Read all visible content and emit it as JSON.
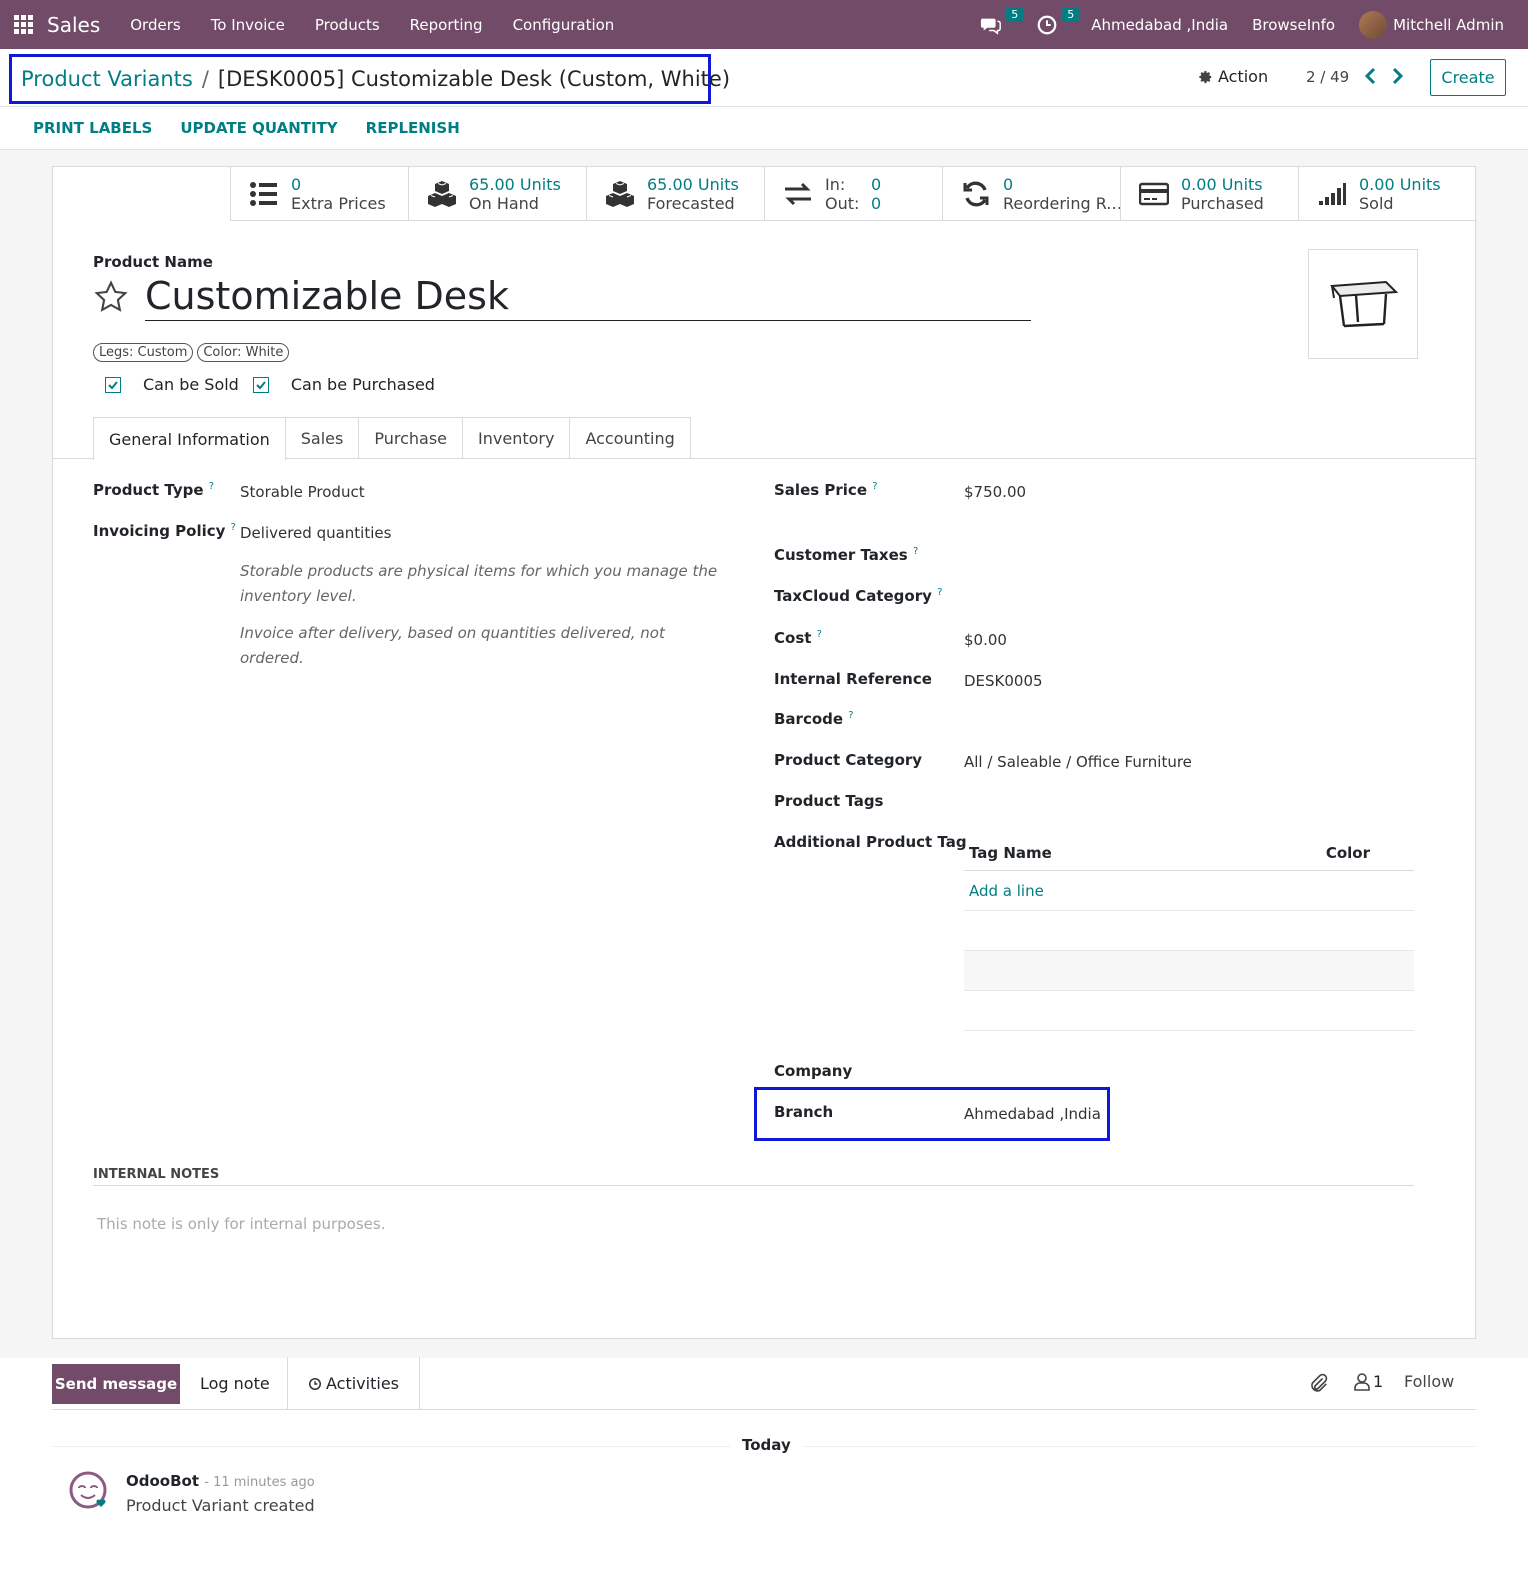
{
  "topnav": {
    "brand": "Sales",
    "menu": [
      "Orders",
      "To Invoice",
      "Products",
      "Reporting",
      "Configuration"
    ],
    "messages_count": "5",
    "activities_count": "5",
    "branch": "Ahmedabad ,India",
    "company": "BrowseInfo",
    "user": "Mitchell Admin",
    "accent": "#714b67"
  },
  "control": {
    "breadcrumb_parent": "Product Variants",
    "breadcrumb_sep": "/",
    "breadcrumb_current": "[DESK0005] Customizable Desk (Custom, White)",
    "action_label": "Action",
    "pager": "2 / 49",
    "create_label": "Create"
  },
  "header_buttons": [
    "PRINT LABELS",
    "UPDATE QUANTITY",
    "REPLENISH"
  ],
  "smart_buttons": {
    "extra_prices": {
      "value": "0",
      "label": "Extra Prices",
      "icon": "list-icon"
    },
    "on_hand": {
      "value": "65.00 Units",
      "label": "On Hand",
      "icon": "cubes-icon"
    },
    "forecasted": {
      "value": "65.00 Units",
      "label": "Forecasted",
      "icon": "cubes-icon"
    },
    "in_out": {
      "in_label": "In:",
      "in_value": "0",
      "out_label": "Out:",
      "out_value": "0",
      "icon": "exchange-icon"
    },
    "reordering": {
      "value": "0",
      "label": "Reordering Rules",
      "icon": "refresh-icon"
    },
    "purchased": {
      "value": "0.00 Units",
      "label": "Purchased",
      "icon": "credit-card-icon"
    },
    "sold": {
      "value": "0.00 Units",
      "label": "Sold",
      "icon": "signal-icon"
    }
  },
  "product": {
    "name_label": "Product Name",
    "name": "Customizable Desk",
    "attributes": [
      "Legs: Custom",
      "Color: White"
    ],
    "can_be_sold_label": "Can be Sold",
    "can_be_purchased_label": "Can be Purchased"
  },
  "tabs": [
    "General Information",
    "Sales",
    "Purchase",
    "Inventory",
    "Accounting"
  ],
  "general": {
    "product_type_label": "Product Type",
    "product_type": "Storable Product",
    "invoicing_policy_label": "Invoicing Policy",
    "invoicing_policy": "Delivered quantities",
    "help_storable": "Storable products are physical items for which you manage the inventory level.",
    "help_invoice": "Invoice after delivery, based on quantities delivered, not ordered.",
    "sales_price_label": "Sales Price",
    "sales_price": "$750.00",
    "customer_taxes_label": "Customer Taxes",
    "taxcloud_label": "TaxCloud Category",
    "cost_label": "Cost",
    "cost": "$0.00",
    "internal_ref_label": "Internal Reference",
    "internal_ref": "DESK0005",
    "barcode_label": "Barcode",
    "category_label": "Product Category",
    "category": "All / Saleable / Office Furniture",
    "product_tags_label": "Product Tags",
    "additional_tag_label": "Additional Product Tag",
    "tag_table": {
      "col_name": "Tag Name",
      "col_color": "Color",
      "add_line": "Add a line"
    },
    "company_label": "Company",
    "branch_label": "Branch",
    "branch": "Ahmedabad ,India",
    "help_marker": "?"
  },
  "notes": {
    "title": "INTERNAL NOTES",
    "placeholder": "This note is only for internal purposes."
  },
  "chatter": {
    "send_message": "Send message",
    "log_note": "Log note",
    "activities": "Activities",
    "followers_count": "1",
    "follow": "Follow",
    "today": "Today",
    "author": "OdooBot",
    "time": "- 11 minutes ago",
    "message": "Product Variant created"
  }
}
